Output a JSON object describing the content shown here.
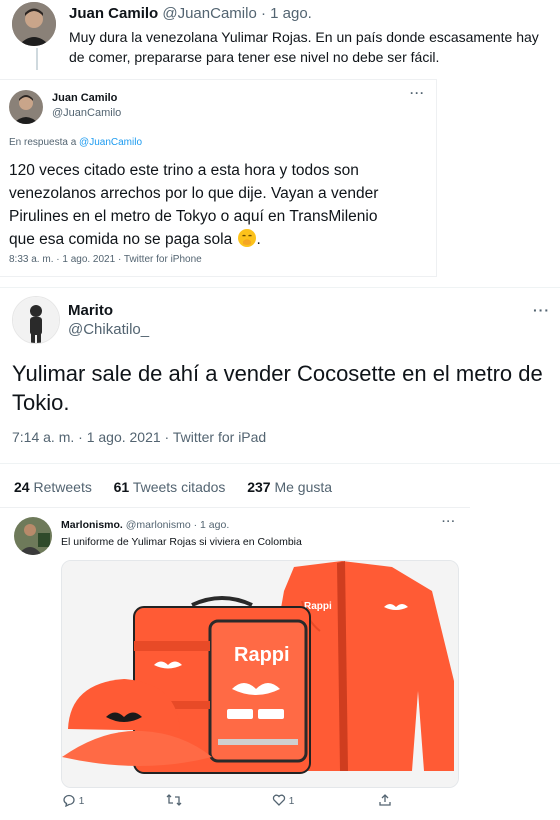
{
  "tweet_top": {
    "name": "Juan Camilo",
    "handle": "@JuanCamilo",
    "time": "· 1 ago.",
    "text_line1": "Muy dura la venezolana Yulimar Rojas. En un país donde escasamente hay",
    "text_line2": "de comer, prepararse para tener ese nivel no debe ser fácil."
  },
  "quote_card": {
    "name": "Juan Camilo",
    "handle": "@JuanCamilo",
    "reply_prefix": "En respuesta a",
    "reply_to": "@JuanCamilo",
    "text_line1": "120 veces citado este trino a esta hora y todos son",
    "text_line2": "venezolanos arrechos por lo que dije. Vayan a vender",
    "text_line3": "Pirulines en el metro de Tokyo o aquí en TransMilenio",
    "text_line4": "que esa comida no se paga sola",
    "text_end": ".",
    "meta": "8:33 a. m. · 1 ago. 2021 · Twitter for iPhone"
  },
  "main_tweet": {
    "name": "Marito",
    "handle": "@Chikatilo_",
    "text_line1": "Yulimar sale de ahí a vender Cocosette en el metro de",
    "text_line2": "Tokio.",
    "meta": "7:14 a. m. · 1 ago. 2021 · Twitter for iPad",
    "stats": [
      {
        "count": "24",
        "label": "Retweets"
      },
      {
        "count": "61",
        "label": "Tweets citados"
      },
      {
        "count": "237",
        "label": "Me gusta"
      }
    ]
  },
  "reply_tweet": {
    "name": "Marlonismo.",
    "handle": "@marlonismo",
    "time": "· 1 ago.",
    "text": "El uniforme de Yulimar Rojas si viviera en Colombia",
    "image_brand": "Rappi",
    "actions": {
      "reply_count": "1",
      "retweet_count": "",
      "like_count": "1"
    }
  },
  "colors": {
    "accent": "#1d9bf0",
    "rappi_orange": "#ff5b35",
    "text": "#0f1419",
    "muted": "#536471"
  }
}
